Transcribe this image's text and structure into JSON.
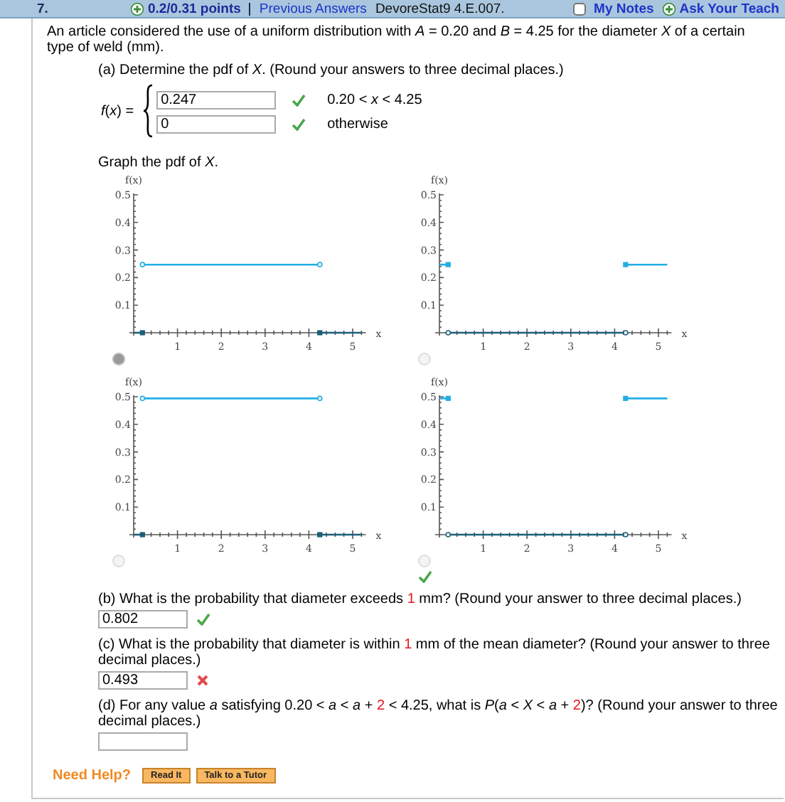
{
  "header": {
    "number": "7.",
    "points": "0.2/0.31 points",
    "previous_answers": "Previous Answers",
    "problem_id": "DevoreStat9 4.E.007.",
    "my_notes": "My Notes",
    "my_notes_checked": false,
    "ask": "Ask Your Teach"
  },
  "intro": "An article considered the use of a uniform distribution with *A* = 0.20 and *B* = 4.25 for the diameter *X* of a certain type of weld (mm).",
  "part_a": {
    "question": "(a) Determine the pdf of *X*. (Round your answers to three decimal places.)",
    "function_label": "*f*(*x*) =",
    "pieces": [
      {
        "value": "0.247",
        "correct": true,
        "condition": "0.20 < *x* < 4.25"
      },
      {
        "value": "0",
        "correct": true,
        "condition": "otherwise"
      }
    ],
    "graph_prompt": "Graph the pdf of *X*.",
    "graphs": [
      {
        "selected": true,
        "marked_correct": false,
        "chart_data": {
          "type": "line",
          "xlabel": "x",
          "ylabel": "f(x)",
          "x": [
            0,
            0.2,
            4.25,
            5.2
          ],
          "xlim": [
            -0.1,
            5.3
          ],
          "ylim": [
            0,
            0.5
          ],
          "xticks": [
            1,
            2,
            3,
            4,
            5
          ],
          "yticks": [
            0.1,
            0.2,
            0.3,
            0.4,
            0.5
          ],
          "series": [
            {
              "color": "#22aee3",
              "marker": "open-circle",
              "values": [
                null,
                0.247,
                0.247,
                null
              ]
            },
            {
              "color": "#1b5f78",
              "marker": "square",
              "values": [
                0,
                0,
                null,
                null
              ]
            },
            {
              "color": "#1b5f78",
              "marker": "square",
              "values": [
                null,
                null,
                0,
                0
              ]
            }
          ]
        }
      },
      {
        "selected": false,
        "marked_correct": false,
        "chart_data": {
          "type": "line",
          "xlabel": "x",
          "ylabel": "f(x)",
          "x": [
            0,
            0.2,
            4.25,
            5.2
          ],
          "xlim": [
            -0.1,
            5.3
          ],
          "ylim": [
            0,
            0.5
          ],
          "xticks": [
            1,
            2,
            3,
            4,
            5
          ],
          "yticks": [
            0.1,
            0.2,
            0.3,
            0.4,
            0.5
          ],
          "series": [
            {
              "color": "#1b5f78",
              "marker": "open-circle",
              "values": [
                null,
                0,
                0,
                null
              ]
            },
            {
              "color": "#22aee3",
              "marker": "square",
              "values": [
                0.247,
                0.247,
                null,
                null
              ]
            },
            {
              "color": "#22aee3",
              "marker": "square",
              "values": [
                null,
                null,
                0.247,
                0.247
              ]
            }
          ]
        }
      },
      {
        "selected": false,
        "marked_correct": false,
        "chart_data": {
          "type": "line",
          "xlabel": "x",
          "ylabel": "f(x)",
          "x": [
            0,
            0.2,
            4.25,
            5.2
          ],
          "xlim": [
            -0.1,
            5.3
          ],
          "ylim": [
            0,
            0.5
          ],
          "xticks": [
            1,
            2,
            3,
            4,
            5
          ],
          "yticks": [
            0.1,
            0.2,
            0.3,
            0.4,
            0.5
          ],
          "series": [
            {
              "color": "#22aee3",
              "marker": "open-circle",
              "values": [
                null,
                0.494,
                0.494,
                null
              ]
            },
            {
              "color": "#1b5f78",
              "marker": "square",
              "values": [
                0,
                0,
                null,
                null
              ]
            },
            {
              "color": "#1b5f78",
              "marker": "square",
              "values": [
                null,
                null,
                0,
                0
              ]
            }
          ]
        }
      },
      {
        "selected": false,
        "marked_correct": true,
        "chart_data": {
          "type": "line",
          "xlabel": "x",
          "ylabel": "f(x)",
          "x": [
            0,
            0.2,
            4.25,
            5.2
          ],
          "xlim": [
            -0.1,
            5.3
          ],
          "ylim": [
            0,
            0.5
          ],
          "xticks": [
            1,
            2,
            3,
            4,
            5
          ],
          "yticks": [
            0.1,
            0.2,
            0.3,
            0.4,
            0.5
          ],
          "series": [
            {
              "color": "#1b5f78",
              "marker": "open-circle",
              "values": [
                null,
                0,
                0,
                null
              ]
            },
            {
              "color": "#22aee3",
              "marker": "square",
              "values": [
                0.494,
                0.494,
                null,
                null
              ]
            },
            {
              "color": "#22aee3",
              "marker": "square",
              "values": [
                null,
                null,
                0.494,
                0.494
              ]
            }
          ]
        }
      }
    ]
  },
  "questions": [
    {
      "parts": [
        {
          "text": "(b) What is the probability that diameter exceeds ",
          "kind": "plain"
        },
        {
          "text": "1",
          "kind": "highlight"
        },
        {
          "text": " mm? (Round your answer to three decimal places.)",
          "kind": "plain"
        }
      ],
      "value": "0.802",
      "correct": true
    },
    {
      "parts": [
        {
          "text": "(c) What is the probability that diameter is within ",
          "kind": "plain"
        },
        {
          "text": "1",
          "kind": "highlight"
        },
        {
          "text": " mm of the mean diameter? (Round your answer to three decimal places.)",
          "kind": "plain"
        }
      ],
      "value": "0.493",
      "correct": false
    },
    {
      "parts": [
        {
          "text": "(d) For any value *a* satisfying  0.20 < *a* < *a* + ",
          "kind": "plain"
        },
        {
          "text": "2",
          "kind": "highlight"
        },
        {
          "text": " < 4.25,  what is  *P*(*a* < *X* < *a* + ",
          "kind": "plain"
        },
        {
          "text": "2",
          "kind": "highlight"
        },
        {
          "text": ")?  (Round your answer to three decimal places.)",
          "kind": "plain"
        }
      ]
    }
  ],
  "help": {
    "label": "Need Help?",
    "buttons": [
      "Read It",
      "Talk to a Tutor"
    ]
  }
}
